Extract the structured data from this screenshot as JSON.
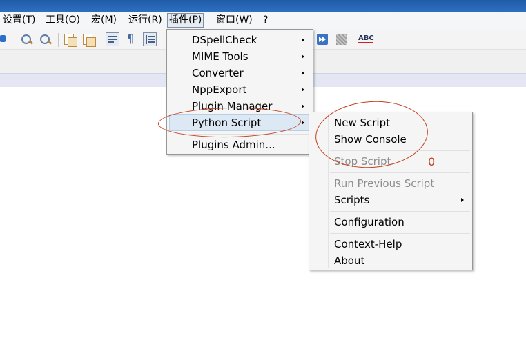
{
  "menubar": {
    "items": [
      "设置(T)",
      "工具(O)",
      "宏(M)",
      "运行(R)",
      "插件(P)",
      "窗口(W)",
      "?"
    ]
  },
  "plugins_menu": {
    "items": [
      "DSpellCheck",
      "MIME Tools",
      "Converter",
      "NppExport",
      "Plugin Manager",
      "Python Script",
      "Plugins Admin..."
    ]
  },
  "python_menu": {
    "items": [
      "New Script",
      "Show Console",
      "Stop Script",
      "Run Previous Script",
      "Scripts",
      "Configuration",
      "Context-Help",
      "About"
    ]
  },
  "toolbar": {
    "icons": [
      "zoom-in-icon",
      "zoom-out-icon",
      "sync-v-icon",
      "sync-h-icon",
      "word-wrap-icon",
      "pilcrow-icon",
      "indent-guide-icon",
      "fast-forward-icon",
      "macro-icon",
      "spellcheck-icon"
    ],
    "spellcheck_label": "ABC"
  },
  "annotation": {
    "label": "0"
  },
  "colors": {
    "annotation": "#c2411f",
    "highlight": "#dde8f5",
    "titlebar": "#1f5ca8"
  }
}
